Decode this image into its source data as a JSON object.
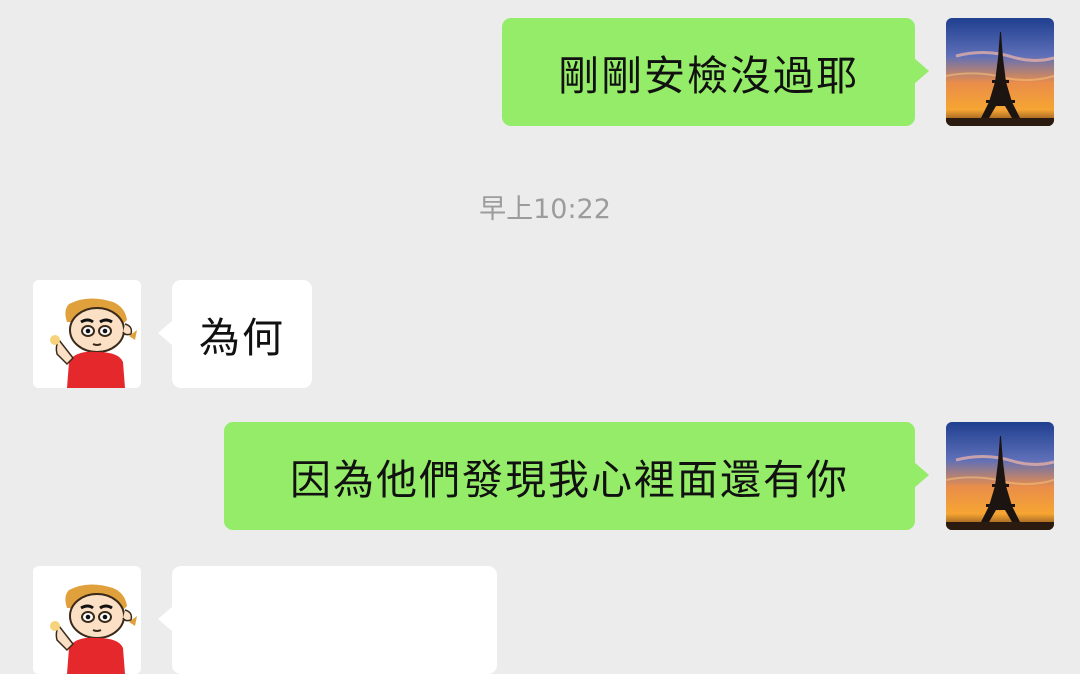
{
  "conversation": {
    "messages": [
      {
        "side": "sent",
        "text": "剛剛安檢沒過耶",
        "avatar": "eiffel-tower-sunset-avatar"
      },
      {
        "side": "received",
        "text": "為何",
        "avatar": "cartoon-boy-avatar"
      },
      {
        "side": "sent",
        "text": "因為他們發現我心裡面還有你",
        "avatar": "eiffel-tower-sunset-avatar"
      }
    ],
    "timestamp": "早上10:22"
  },
  "colors": {
    "background": "#ececec",
    "sent_bubble": "#95ec69",
    "received_bubble": "#ffffff",
    "timestamp_text": "#9c9c9c"
  }
}
